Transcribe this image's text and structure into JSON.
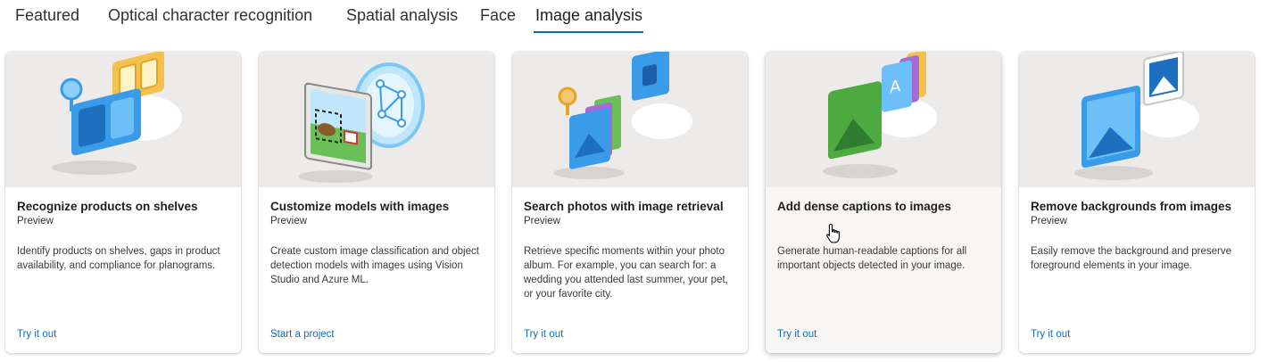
{
  "tabs": [
    {
      "label": "Featured"
    },
    {
      "label": "Optical character recognition"
    },
    {
      "label": "Spatial analysis"
    },
    {
      "label": "Face"
    },
    {
      "label": "Image analysis"
    }
  ],
  "active_tab": "Image analysis",
  "accent_color": "#0f6cbd",
  "cards": [
    {
      "title": "Recognize products on shelves",
      "subtitle": "Preview",
      "description": "Identify products on shelves, gaps in product availability, and compliance for planograms.",
      "link": "Try it out",
      "icon": "products-on-shelves-illustration"
    },
    {
      "title": "Customize models with images",
      "subtitle": "Preview",
      "description": "Create custom image classification and object detection models with images using Vision Studio and Azure ML.",
      "link": "Start a project",
      "icon": "custom-model-illustration"
    },
    {
      "title": "Search photos with image retrieval",
      "subtitle": "Preview",
      "description": "Retrieve specific moments within your photo album. For example, you can search for: a wedding you attended last summer, your pet, or your favorite city.",
      "link": "Try it out",
      "icon": "image-retrieval-illustration"
    },
    {
      "title": "Add dense captions to images",
      "subtitle": "",
      "description": "Generate human-readable captions for all important objects detected in your image.",
      "link": "Try it out",
      "icon": "dense-captions-illustration"
    },
    {
      "title": "Remove backgrounds from images",
      "subtitle": "Preview",
      "description": "Easily remove the background and preserve foreground elements in your image.",
      "link": "Try it out",
      "icon": "background-removal-illustration"
    }
  ]
}
